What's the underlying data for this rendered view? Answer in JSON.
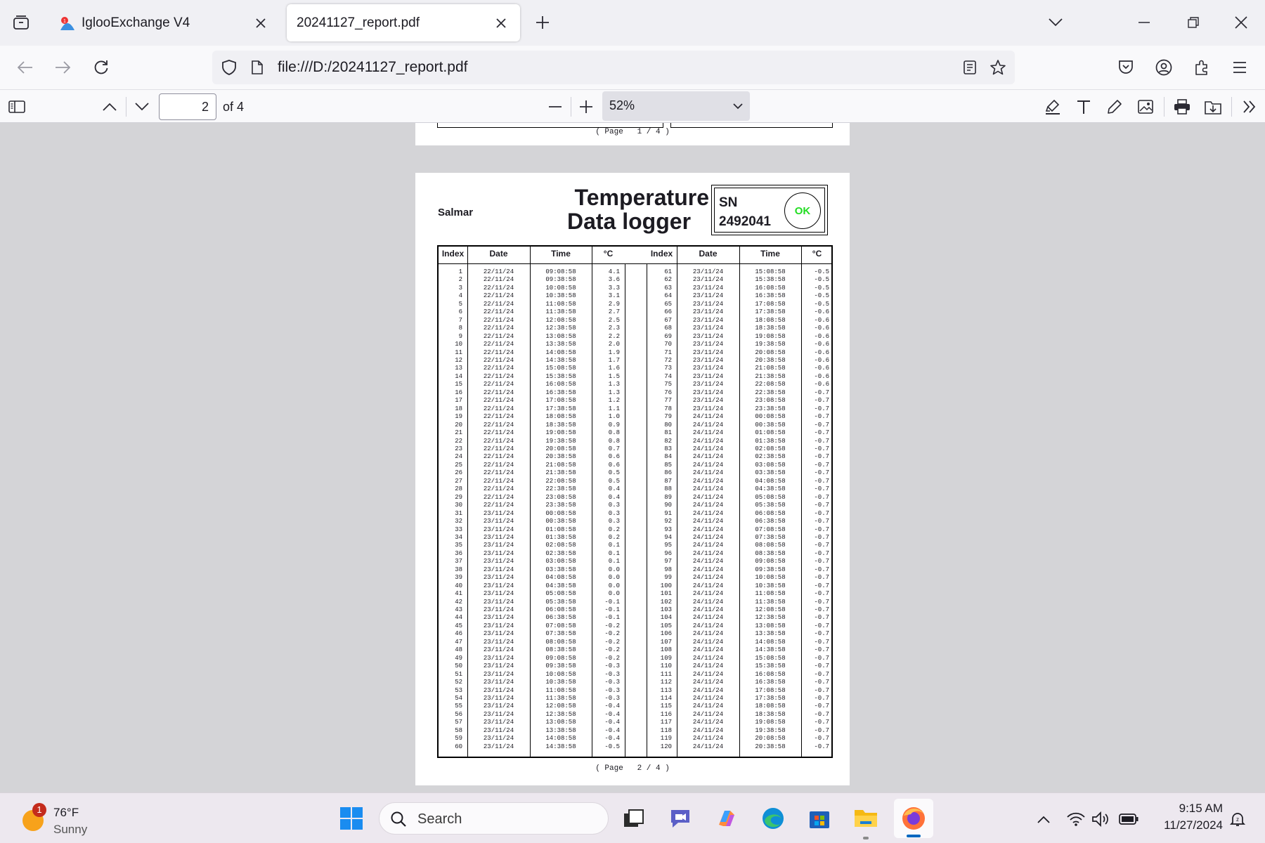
{
  "browser": {
    "tabs": [
      {
        "title": "IglooExchange V4",
        "active": false
      },
      {
        "title": "20241127_report.pdf",
        "active": true
      }
    ],
    "url": "file:///D:/20241127_report.pdf"
  },
  "pdf_toolbar": {
    "page_current": "2",
    "page_total_label": "of 4",
    "zoom": "52%"
  },
  "prev_page": {
    "footer": "( Page   1 / 4 )"
  },
  "page2": {
    "company": "Salmar",
    "title_line1": "Temperature",
    "title_line2": "Data logger",
    "sn_label": "SN",
    "sn_value": "2492041",
    "status": "OK",
    "status_color": "#22dd22",
    "headers": [
      "Index",
      "Date",
      "Time",
      "°C",
      "Index",
      "Date",
      "Time",
      "°C"
    ],
    "left": {
      "index": [
        "1",
        "2",
        "3",
        "4",
        "5",
        "6",
        "7",
        "8",
        "9",
        "10",
        "11",
        "12",
        "13",
        "14",
        "15",
        "16",
        "17",
        "18",
        "19",
        "20",
        "21",
        "22",
        "23",
        "24",
        "25",
        "26",
        "27",
        "28",
        "29",
        "30",
        "31",
        "32",
        "33",
        "34",
        "35",
        "36",
        "37",
        "38",
        "39",
        "40",
        "41",
        "42",
        "43",
        "44",
        "45",
        "46",
        "47",
        "48",
        "49",
        "50",
        "51",
        "52",
        "53",
        "54",
        "55",
        "56",
        "57",
        "58",
        "59",
        "60"
      ],
      "date": [
        "22/11/24",
        "22/11/24",
        "22/11/24",
        "22/11/24",
        "22/11/24",
        "22/11/24",
        "22/11/24",
        "22/11/24",
        "22/11/24",
        "22/11/24",
        "22/11/24",
        "22/11/24",
        "22/11/24",
        "22/11/24",
        "22/11/24",
        "22/11/24",
        "22/11/24",
        "22/11/24",
        "22/11/24",
        "22/11/24",
        "22/11/24",
        "22/11/24",
        "22/11/24",
        "22/11/24",
        "22/11/24",
        "22/11/24",
        "22/11/24",
        "22/11/24",
        "22/11/24",
        "22/11/24",
        "23/11/24",
        "23/11/24",
        "23/11/24",
        "23/11/24",
        "23/11/24",
        "23/11/24",
        "23/11/24",
        "23/11/24",
        "23/11/24",
        "23/11/24",
        "23/11/24",
        "23/11/24",
        "23/11/24",
        "23/11/24",
        "23/11/24",
        "23/11/24",
        "23/11/24",
        "23/11/24",
        "23/11/24",
        "23/11/24",
        "23/11/24",
        "23/11/24",
        "23/11/24",
        "23/11/24",
        "23/11/24",
        "23/11/24",
        "23/11/24",
        "23/11/24",
        "23/11/24",
        "23/11/24"
      ],
      "time": [
        "09:08:58",
        "09:38:58",
        "10:08:58",
        "10:38:58",
        "11:08:58",
        "11:38:58",
        "12:08:58",
        "12:38:58",
        "13:08:58",
        "13:38:58",
        "14:08:58",
        "14:38:58",
        "15:08:58",
        "15:38:58",
        "16:08:58",
        "16:38:58",
        "17:08:58",
        "17:38:58",
        "18:08:58",
        "18:38:58",
        "19:08:58",
        "19:38:58",
        "20:08:58",
        "20:38:58",
        "21:08:58",
        "21:38:58",
        "22:08:58",
        "22:38:58",
        "23:08:58",
        "23:38:58",
        "00:08:58",
        "00:38:58",
        "01:08:58",
        "01:38:58",
        "02:08:58",
        "02:38:58",
        "03:08:58",
        "03:38:58",
        "04:08:58",
        "04:38:58",
        "05:08:58",
        "05:38:58",
        "06:08:58",
        "06:38:58",
        "07:08:58",
        "07:38:58",
        "08:08:58",
        "08:38:58",
        "09:08:58",
        "09:38:58",
        "10:08:58",
        "10:38:58",
        "11:08:58",
        "11:38:58",
        "12:08:58",
        "12:38:58",
        "13:08:58",
        "13:38:58",
        "14:08:58",
        "14:38:58"
      ],
      "temp": [
        "4.1",
        "3.6",
        "3.3",
        "3.1",
        "2.9",
        "2.7",
        "2.5",
        "2.3",
        "2.2",
        "2.0",
        "1.9",
        "1.7",
        "1.6",
        "1.5",
        "1.3",
        "1.3",
        "1.2",
        "1.1",
        "1.0",
        "0.9",
        "0.8",
        "0.8",
        "0.7",
        "0.6",
        "0.6",
        "0.5",
        "0.5",
        "0.4",
        "0.4",
        "0.3",
        "0.3",
        "0.3",
        "0.2",
        "0.2",
        "0.1",
        "0.1",
        "0.1",
        "0.0",
        "0.0",
        "0.0",
        "0.0",
        "-0.1",
        "-0.1",
        "-0.1",
        "-0.2",
        "-0.2",
        "-0.2",
        "-0.2",
        "-0.2",
        "-0.3",
        "-0.3",
        "-0.3",
        "-0.3",
        "-0.3",
        "-0.4",
        "-0.4",
        "-0.4",
        "-0.4",
        "-0.4",
        "-0.5"
      ]
    },
    "right": {
      "index": [
        "61",
        "62",
        "63",
        "64",
        "65",
        "66",
        "67",
        "68",
        "69",
        "70",
        "71",
        "72",
        "73",
        "74",
        "75",
        "76",
        "77",
        "78",
        "79",
        "80",
        "81",
        "82",
        "83",
        "84",
        "85",
        "86",
        "87",
        "88",
        "89",
        "90",
        "91",
        "92",
        "93",
        "94",
        "95",
        "96",
        "97",
        "98",
        "99",
        "100",
        "101",
        "102",
        "103",
        "104",
        "105",
        "106",
        "107",
        "108",
        "109",
        "110",
        "111",
        "112",
        "113",
        "114",
        "115",
        "116",
        "117",
        "118",
        "119",
        "120"
      ],
      "date": [
        "23/11/24",
        "23/11/24",
        "23/11/24",
        "23/11/24",
        "23/11/24",
        "23/11/24",
        "23/11/24",
        "23/11/24",
        "23/11/24",
        "23/11/24",
        "23/11/24",
        "23/11/24",
        "23/11/24",
        "23/11/24",
        "23/11/24",
        "23/11/24",
        "23/11/24",
        "23/11/24",
        "24/11/24",
        "24/11/24",
        "24/11/24",
        "24/11/24",
        "24/11/24",
        "24/11/24",
        "24/11/24",
        "24/11/24",
        "24/11/24",
        "24/11/24",
        "24/11/24",
        "24/11/24",
        "24/11/24",
        "24/11/24",
        "24/11/24",
        "24/11/24",
        "24/11/24",
        "24/11/24",
        "24/11/24",
        "24/11/24",
        "24/11/24",
        "24/11/24",
        "24/11/24",
        "24/11/24",
        "24/11/24",
        "24/11/24",
        "24/11/24",
        "24/11/24",
        "24/11/24",
        "24/11/24",
        "24/11/24",
        "24/11/24",
        "24/11/24",
        "24/11/24",
        "24/11/24",
        "24/11/24",
        "24/11/24",
        "24/11/24",
        "24/11/24",
        "24/11/24",
        "24/11/24",
        "24/11/24"
      ],
      "time": [
        "15:08:58",
        "15:38:58",
        "16:08:58",
        "16:38:58",
        "17:08:58",
        "17:38:58",
        "18:08:58",
        "18:38:58",
        "19:08:58",
        "19:38:58",
        "20:08:58",
        "20:38:58",
        "21:08:58",
        "21:38:58",
        "22:08:58",
        "22:38:58",
        "23:08:58",
        "23:38:58",
        "00:08:58",
        "00:38:58",
        "01:08:58",
        "01:38:58",
        "02:08:58",
        "02:38:58",
        "03:08:58",
        "03:38:58",
        "04:08:58",
        "04:38:58",
        "05:08:58",
        "05:38:58",
        "06:08:58",
        "06:38:58",
        "07:08:58",
        "07:38:58",
        "08:08:58",
        "08:38:58",
        "09:08:58",
        "09:38:58",
        "10:08:58",
        "10:38:58",
        "11:08:58",
        "11:38:58",
        "12:08:58",
        "12:38:58",
        "13:08:58",
        "13:38:58",
        "14:08:58",
        "14:38:58",
        "15:08:58",
        "15:38:58",
        "16:08:58",
        "16:38:58",
        "17:08:58",
        "17:38:58",
        "18:08:58",
        "18:38:58",
        "19:08:58",
        "19:38:58",
        "20:08:58",
        "20:38:58"
      ],
      "temp": [
        "-0.5",
        "-0.5",
        "-0.5",
        "-0.5",
        "-0.5",
        "-0.6",
        "-0.6",
        "-0.6",
        "-0.6",
        "-0.6",
        "-0.6",
        "-0.6",
        "-0.6",
        "-0.6",
        "-0.6",
        "-0.7",
        "-0.7",
        "-0.7",
        "-0.7",
        "-0.7",
        "-0.7",
        "-0.7",
        "-0.7",
        "-0.7",
        "-0.7",
        "-0.7",
        "-0.7",
        "-0.7",
        "-0.7",
        "-0.7",
        "-0.7",
        "-0.7",
        "-0.7",
        "-0.7",
        "-0.7",
        "-0.7",
        "-0.7",
        "-0.7",
        "-0.7",
        "-0.7",
        "-0.7",
        "-0.7",
        "-0.7",
        "-0.7",
        "-0.7",
        "-0.7",
        "-0.7",
        "-0.7",
        "-0.7",
        "-0.7",
        "-0.7",
        "-0.7",
        "-0.7",
        "-0.7",
        "-0.7",
        "-0.7",
        "-0.7",
        "-0.7",
        "-0.7",
        "-0.7"
      ]
    },
    "footer": "( Page   2 / 4 )"
  },
  "taskbar": {
    "weather_temp": "76°F",
    "weather_desc": "Sunny",
    "weather_badge": "1",
    "search_placeholder": "Search",
    "time": "9:15 AM",
    "date": "11/27/2024"
  },
  "icons": [
    "tab-overview-icon",
    "close-icon",
    "plus-icon",
    "chevron-down-icon",
    "minimize-icon",
    "restore-icon",
    "back-icon",
    "forward-icon",
    "reload-icon",
    "shield-icon",
    "page-icon",
    "reader-view-icon",
    "star-icon",
    "pocket-icon",
    "account-icon",
    "extensions-icon",
    "menu-icon",
    "sidebar-icon",
    "chevron-up-icon",
    "zoom-out-icon",
    "zoom-in-icon",
    "highlight-icon",
    "text-icon",
    "draw-icon",
    "image-icon",
    "print-icon",
    "save-icon",
    "more-tools-icon",
    "windows-start-icon",
    "search-icon",
    "wifi-icon",
    "volume-icon",
    "battery-icon"
  ]
}
